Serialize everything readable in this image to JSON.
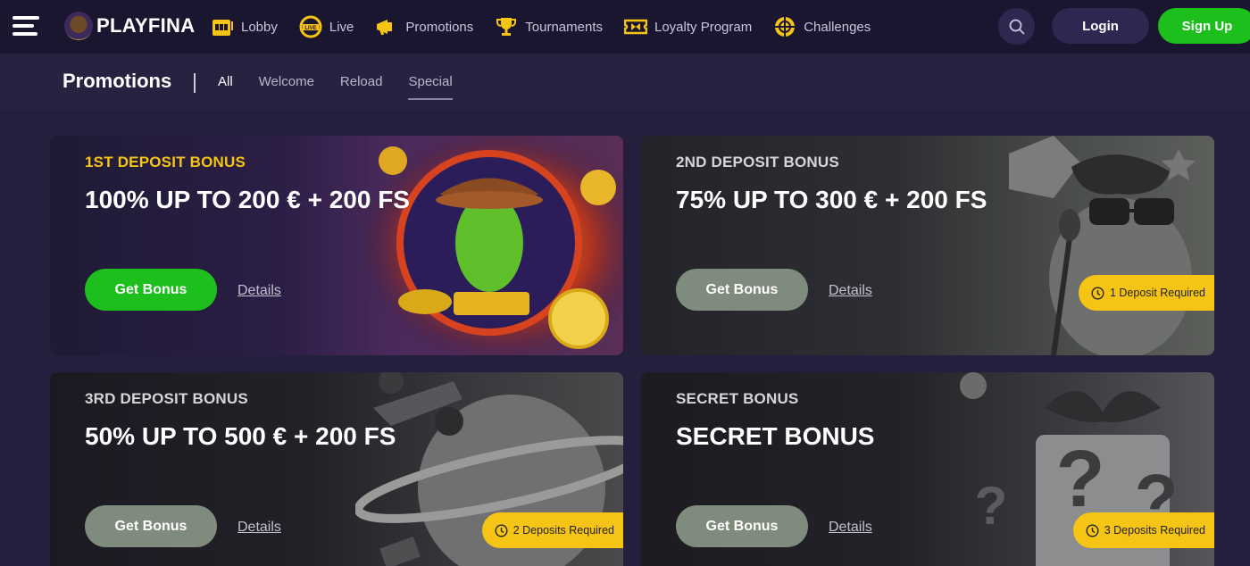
{
  "header": {
    "brand": "PLAYFINA",
    "nav": [
      {
        "label": "Lobby",
        "icon": "slot-machine-icon"
      },
      {
        "label": "Live",
        "icon": "live-chip-icon"
      },
      {
        "label": "Promotions",
        "icon": "megaphone-icon"
      },
      {
        "label": "Tournaments",
        "icon": "trophy-icon"
      },
      {
        "label": "Loyalty Program",
        "icon": "ticket-icon"
      },
      {
        "label": "Challenges",
        "icon": "target-icon"
      }
    ],
    "login_label": "Login",
    "signup_label": "Sign Up"
  },
  "subheader": {
    "title": "Promotions",
    "tabs": [
      "All",
      "Welcome",
      "Reload",
      "Special"
    ]
  },
  "cards": [
    {
      "eyebrow": "1ST DEPOSIT BONUS",
      "headline": "100% UP TO 200 € + 200 FS",
      "button": "Get Bonus",
      "details": "Details",
      "eyebrow_color": "#f5c414"
    },
    {
      "eyebrow": "2ND DEPOSIT BONUS",
      "headline": "75% UP TO 300 € + 200 FS",
      "button": "Get Bonus",
      "details": "Details",
      "requirement": "1 Deposit Required",
      "eyebrow_color": "#d6d6d6"
    },
    {
      "eyebrow": "3RD DEPOSIT BONUS",
      "headline": "50% UP TO 500 € + 200 FS",
      "button": "Get Bonus",
      "details": "Details",
      "requirement": "2 Deposits Required",
      "eyebrow_color": "#d6d6d6"
    },
    {
      "eyebrow": "SECRET BONUS",
      "headline": "SECRET BONUS",
      "button": "Get Bonus",
      "details": "Details",
      "requirement": "3 Deposits Required",
      "eyebrow_color": "#d6d6d6"
    }
  ],
  "colors": {
    "accent_green": "#1dbf1d",
    "badge_yellow": "#f5c414",
    "nav_bg": "#1a1630",
    "page_bg": "#231f3c"
  }
}
